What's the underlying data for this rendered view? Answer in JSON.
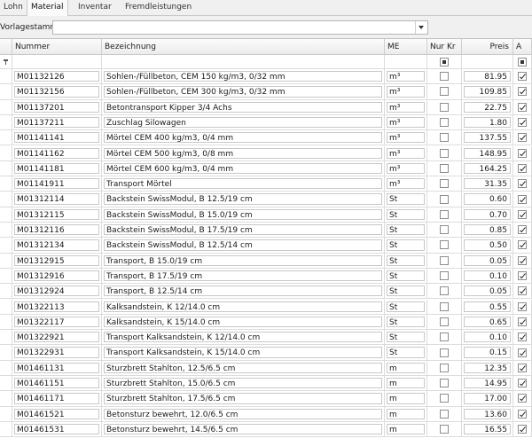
{
  "tabs": [
    {
      "label": "Lohn",
      "active": false
    },
    {
      "label": "Material",
      "active": true
    },
    {
      "label": "Inventar",
      "active": false
    },
    {
      "label": "Fremdleistungen",
      "active": false
    }
  ],
  "vorlage": {
    "label": "Vorlagestamm",
    "value": ""
  },
  "columns": {
    "nummer": "Nummer",
    "bezeichnung": "Bezeichnung",
    "me": "ME",
    "nurkr": "Nur Kr",
    "preis": "Preis",
    "a": "A"
  },
  "rows": [
    {
      "nummer": "M01132126",
      "bezeichnung": "Sohlen-/Füllbeton, CEM 150 kg/m3,  0/32 mm",
      "me": "m³",
      "preis": "81.95"
    },
    {
      "nummer": "M01132156",
      "bezeichnung": "Sohlen-/Füllbeton, CEM 300 kg/m3,  0/32 mm",
      "me": "m³",
      "preis": "109.85"
    },
    {
      "nummer": "M01137201",
      "bezeichnung": "Betontransport Kipper 3/4 Achs",
      "me": "m³",
      "preis": "22.75"
    },
    {
      "nummer": "M01137211",
      "bezeichnung": "Zuschlag Silowagen",
      "me": "m³",
      "preis": "1.80"
    },
    {
      "nummer": "M01141141",
      "bezeichnung": "Mörtel CEM 400 kg/m3, 0/4 mm",
      "me": "m³",
      "preis": "137.55"
    },
    {
      "nummer": "M01141162",
      "bezeichnung": "Mörtel CEM 500 kg/m3, 0/8 mm",
      "me": "m³",
      "preis": "148.95"
    },
    {
      "nummer": "M01141181",
      "bezeichnung": "Mörtel CEM 600 kg/m3, 0/4 mm",
      "me": "m³",
      "preis": "164.25"
    },
    {
      "nummer": "M01141911",
      "bezeichnung": "Transport Mörtel",
      "me": "m³",
      "preis": "31.35"
    },
    {
      "nummer": "M01312114",
      "bezeichnung": "Backstein SwissModul, B 12.5/19 cm",
      "me": "St",
      "preis": "0.60"
    },
    {
      "nummer": "M01312115",
      "bezeichnung": "Backstein SwissModul, B 15.0/19 cm",
      "me": "St",
      "preis": "0.70"
    },
    {
      "nummer": "M01312116",
      "bezeichnung": "Backstein SwissModul, B 17.5/19 cm",
      "me": "St",
      "preis": "0.85"
    },
    {
      "nummer": "M01312134",
      "bezeichnung": "Backstein SwissModul, B 12.5/14 cm",
      "me": "St",
      "preis": "0.50"
    },
    {
      "nummer": "M01312915",
      "bezeichnung": "Transport, B 15.0/19 cm",
      "me": "St",
      "preis": "0.05"
    },
    {
      "nummer": "M01312916",
      "bezeichnung": "Transport, B 17.5/19 cm",
      "me": "St",
      "preis": "0.10"
    },
    {
      "nummer": "M01312924",
      "bezeichnung": "Transport, B 12.5/14 cm",
      "me": "St",
      "preis": "0.05"
    },
    {
      "nummer": "M01322113",
      "bezeichnung": "Kalksandstein, K 12/14.0 cm",
      "me": "St",
      "preis": "0.55"
    },
    {
      "nummer": "M01322117",
      "bezeichnung": "Kalksandstein, K 15/14.0 cm",
      "me": "St",
      "preis": "0.65"
    },
    {
      "nummer": "M01322921",
      "bezeichnung": "Transport Kalksandstein, K 12/14.0 cm",
      "me": "St",
      "preis": "0.10"
    },
    {
      "nummer": "M01322931",
      "bezeichnung": "Transport Kalksandstein, K 15/14.0 cm",
      "me": "St",
      "preis": "0.15"
    },
    {
      "nummer": "M01461131",
      "bezeichnung": "Sturzbrett Stahlton, 12.5/6.5 cm",
      "me": "m",
      "preis": "12.35"
    },
    {
      "nummer": "M01461151",
      "bezeichnung": "Sturzbrett Stahlton, 15.0/6.5 cm",
      "me": "m",
      "preis": "14.95"
    },
    {
      "nummer": "M01461171",
      "bezeichnung": "Sturzbrett Stahlton, 17.5/6.5 cm",
      "me": "m",
      "preis": "17.00"
    },
    {
      "nummer": "M01461521",
      "bezeichnung": "Betonsturz bewehrt, 12.0/6.5 cm",
      "me": "m",
      "preis": "13.60"
    },
    {
      "nummer": "M01461531",
      "bezeichnung": "Betonsturz bewehrt, 14.5/6.5 cm",
      "me": "m",
      "preis": "16.55"
    }
  ]
}
